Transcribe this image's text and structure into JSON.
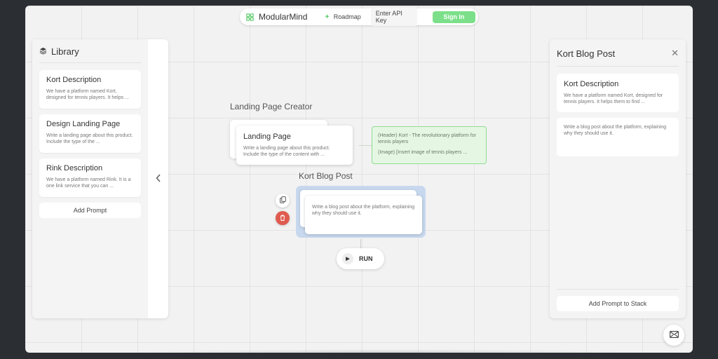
{
  "topbar": {
    "brand": "ModularMind",
    "roadmap": "Roadmap",
    "api_key": "Enter API Key",
    "sign_in": "Sign In"
  },
  "library": {
    "title": "Library",
    "items": [
      {
        "title": "Kort Description",
        "text": "We have a platform named Kort, designed for tennis players. It helps ..."
      },
      {
        "title": "Design Landing Page",
        "text": "Write a landing page about this product. Include the type of the ..."
      },
      {
        "title": "Rink Description",
        "text": "We have a platform named Rink. It is a one link service that you can ..."
      }
    ],
    "add_prompt": "Add Prompt"
  },
  "canvas": {
    "group1": {
      "title": "Landing Page Creator",
      "card_title": "Landing Page",
      "card_text": "Write a landing page about this product. Include the type of the content with ...",
      "output_line1": "(Header) Kort - The revolutionary platform for tennis players",
      "output_line2": "(Image) [Insert image of tennis players ..."
    },
    "group2": {
      "title": "Kort Blog Post",
      "card_text": "Write a blog post about the platform, explaining why they should use it."
    },
    "run": "RUN"
  },
  "right_panel": {
    "title": "Kort Blog Post",
    "card1_title": "Kort Description",
    "card1_text": "We have a platform named Kort, designed for tennis players. It helps them to find ...",
    "card2_text": "Write a blog post about the platform, explaining why they should use it.",
    "add_to_stack": "Add Prompt to Stack"
  },
  "colors": {
    "accent_green": "#7ce08a",
    "output_bg": "#e5f7e3",
    "selected_bg": "#c7d8ee",
    "delete_red": "#e05b4f"
  }
}
